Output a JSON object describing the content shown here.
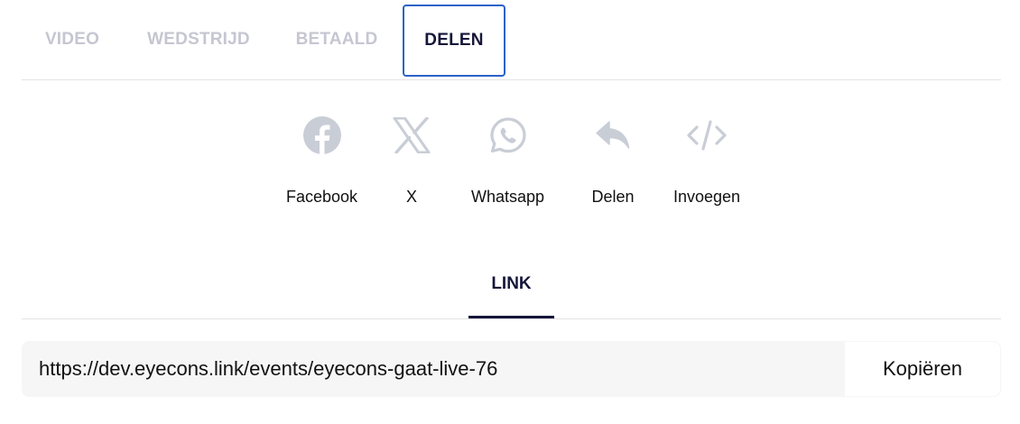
{
  "tabs": [
    {
      "label": "VIDEO",
      "active": false
    },
    {
      "label": "WEDSTRIJD",
      "active": false
    },
    {
      "label": "BETAALD",
      "active": false
    },
    {
      "label": "DELEN",
      "active": true
    }
  ],
  "share": [
    {
      "label": "Facebook",
      "icon": "facebook-icon"
    },
    {
      "label": "X",
      "icon": "x-icon"
    },
    {
      "label": "Whatsapp",
      "icon": "whatsapp-icon"
    },
    {
      "label": "Delen",
      "icon": "reply-icon"
    },
    {
      "label": "Invoegen",
      "icon": "code-icon"
    }
  ],
  "link_tab": {
    "label": "LINK"
  },
  "url_field": {
    "value": "https://dev.eyecons.link/events/eyecons-gaat-live-76"
  },
  "copy_button": {
    "label": "Kopiëren"
  },
  "colors": {
    "active_tab_border": "#2a62c8",
    "inactive_tab_text": "#c6c6d2",
    "active_text": "#16163a",
    "icon_gray": "#c9cdd6"
  }
}
